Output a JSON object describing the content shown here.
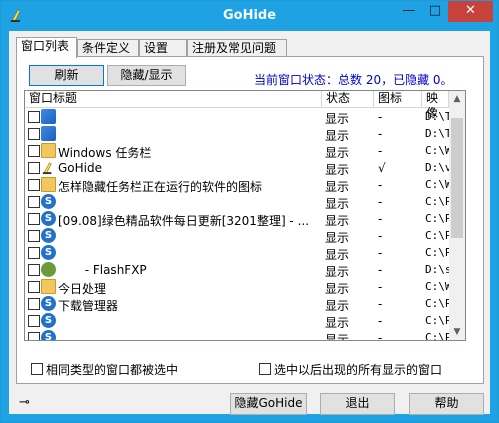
{
  "window": {
    "title": "GoHide",
    "min_glyph": "—",
    "max_glyph": "□",
    "close_glyph": "✕"
  },
  "tabs": [
    {
      "label": "窗口列表"
    },
    {
      "label": "条件定义"
    },
    {
      "label": "设置"
    },
    {
      "label": "注册及常见问题"
    }
  ],
  "toolbar": {
    "refresh_label": "刷新",
    "toggle_label": "隐藏/显示",
    "status_text": "当前窗口状态：总数 20，已隐藏 0。"
  },
  "list": {
    "columns": [
      "窗口标题",
      "状态",
      "图标",
      "映像"
    ],
    "rows": [
      {
        "icon": "windows-icon",
        "title": "",
        "state": "显示",
        "tray": "-",
        "path": "D:\\T"
      },
      {
        "icon": "windows-icon",
        "title": "",
        "state": "显示",
        "tray": "-",
        "path": "D:\\T"
      },
      {
        "icon": "folder-icon",
        "title": "Windows 任务栏",
        "state": "显示",
        "tray": "-",
        "path": "C:\\W"
      },
      {
        "icon": "gohide-icon",
        "title": "GoHide",
        "state": "显示",
        "tray": "√",
        "path": "D:\\v"
      },
      {
        "icon": "folder-icon",
        "title": "怎样隐藏任务栏正在运行的软件的图标",
        "state": "显示",
        "tray": "-",
        "path": "C:\\W"
      },
      {
        "icon": "sogou-icon",
        "title": "",
        "state": "显示",
        "tray": "-",
        "path": "C:\\P"
      },
      {
        "icon": "sogou-icon",
        "title": "[09.08]绿色精品软件每日更新[3201整理] - ...",
        "state": "显示",
        "tray": "-",
        "path": "C:\\P"
      },
      {
        "icon": "sogou-icon",
        "title": "",
        "state": "显示",
        "tray": "-",
        "path": "C:\\P"
      },
      {
        "icon": "sogou-icon",
        "title": "",
        "state": "显示",
        "tray": "-",
        "path": "C:\\P"
      },
      {
        "icon": "flashfxp-icon",
        "title": "       - FlashFXP",
        "state": "显示",
        "tray": "-",
        "path": "D:\\s"
      },
      {
        "icon": "folder-icon",
        "title": "今日处理",
        "state": "显示",
        "tray": "-",
        "path": "C:\\W"
      },
      {
        "icon": "sogou-icon",
        "title": "下载管理器",
        "state": "显示",
        "tray": "-",
        "path": "C:\\P"
      },
      {
        "icon": "sogou-icon",
        "title": "",
        "state": "显示",
        "tray": "-",
        "path": "C:\\P"
      },
      {
        "icon": "sogou-icon",
        "title": "",
        "state": "显示",
        "tray": "-",
        "path": "C:\\P"
      }
    ]
  },
  "options": {
    "same_type_label": "相同类型的窗口都被选中",
    "show_all_label": "选中以后出现的所有显示的窗口"
  },
  "footer": {
    "pin_glyph": "⊸",
    "hide_label": "隐藏GoHide",
    "exit_label": "退出",
    "help_label": "帮助"
  },
  "colors": {
    "titlebar": "#1ea2e4",
    "close": "#c7423a",
    "status_text": "#0000c8"
  }
}
